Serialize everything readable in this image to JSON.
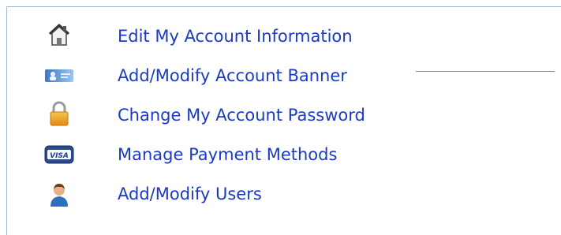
{
  "menu": {
    "items": [
      {
        "label": "Edit My Account Information",
        "icon": "home-icon"
      },
      {
        "label": "Add/Modify Account Banner",
        "icon": "id-card-icon"
      },
      {
        "label": "Change My Account Password",
        "icon": "padlock-icon"
      },
      {
        "label": "Manage Payment Methods",
        "icon": "visa-card-icon"
      },
      {
        "label": "Add/Modify Users",
        "icon": "user-icon"
      }
    ],
    "visa_text": "VISA"
  },
  "colors": {
    "link": "#1a3bc1",
    "panel_border": "#9fb8cf",
    "rule": "#8a8a8a"
  }
}
